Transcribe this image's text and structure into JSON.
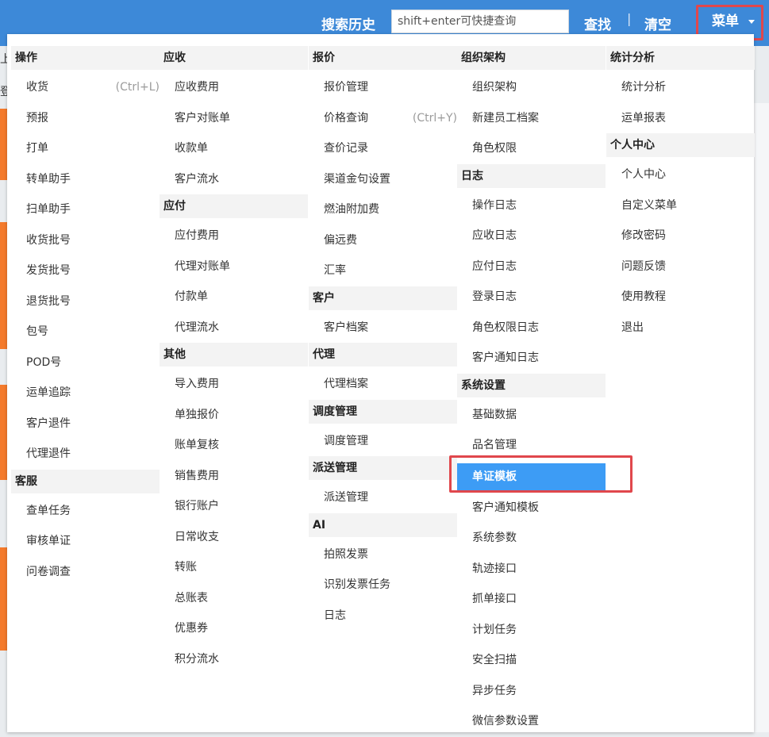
{
  "header": {
    "search_history_label": "搜索历史",
    "search_placeholder": "shift+enter可快捷查询",
    "find_label": "查找",
    "separator": "|",
    "clear_label": "清空",
    "menu_label": "菜单"
  },
  "background": {
    "fragment_char_1": "上",
    "fragment_char_2": "登"
  },
  "menu": {
    "col0": {
      "g0": {
        "title": "操作",
        "items": [
          {
            "label": "收货",
            "shortcut": "(Ctrl+L)"
          },
          {
            "label": "预报"
          },
          {
            "label": "打单"
          },
          {
            "label": "转单助手"
          },
          {
            "label": "扫单助手"
          },
          {
            "label": "收货批号"
          },
          {
            "label": "发货批号"
          },
          {
            "label": "退货批号"
          },
          {
            "label": "包号"
          },
          {
            "label": "POD号"
          },
          {
            "label": "运单追踪"
          },
          {
            "label": "客户退件"
          },
          {
            "label": "代理退件"
          }
        ]
      },
      "g1": {
        "title": "客服",
        "items": [
          {
            "label": "查单任务"
          },
          {
            "label": "审核单证"
          },
          {
            "label": "问卷调查"
          }
        ]
      }
    },
    "col1": {
      "g0": {
        "title": "应收",
        "items": [
          {
            "label": "应收费用"
          },
          {
            "label": "客户对账单"
          },
          {
            "label": "收款单"
          },
          {
            "label": "客户流水"
          }
        ]
      },
      "g1": {
        "title": "应付",
        "items": [
          {
            "label": "应付费用"
          },
          {
            "label": "代理对账单"
          },
          {
            "label": "付款单"
          },
          {
            "label": "代理流水"
          }
        ]
      },
      "g2": {
        "title": "其他",
        "items": [
          {
            "label": "导入费用"
          },
          {
            "label": "单独报价"
          },
          {
            "label": "账单复核"
          },
          {
            "label": "销售费用"
          },
          {
            "label": "银行账户"
          },
          {
            "label": "日常收支"
          },
          {
            "label": "转账"
          },
          {
            "label": "总账表"
          },
          {
            "label": "优惠券"
          },
          {
            "label": "积分流水"
          }
        ]
      }
    },
    "col2": {
      "g0": {
        "title": "报价",
        "items": [
          {
            "label": "报价管理"
          },
          {
            "label": "价格查询",
            "shortcut": "(Ctrl+Y)"
          },
          {
            "label": "查价记录"
          },
          {
            "label": "渠道金句设置"
          },
          {
            "label": "燃油附加费"
          },
          {
            "label": "偏远费"
          },
          {
            "label": "汇率"
          }
        ]
      },
      "g1": {
        "title": "客户",
        "items": [
          {
            "label": "客户档案"
          }
        ]
      },
      "g2": {
        "title": "代理",
        "items": [
          {
            "label": "代理档案"
          }
        ]
      },
      "g3": {
        "title": "调度管理",
        "items": [
          {
            "label": "调度管理"
          }
        ]
      },
      "g4": {
        "title": "派送管理",
        "items": [
          {
            "label": "派送管理"
          }
        ]
      },
      "g5": {
        "title": "AI",
        "items": [
          {
            "label": "拍照发票"
          },
          {
            "label": "识别发票任务"
          },
          {
            "label": "日志"
          }
        ]
      }
    },
    "col3": {
      "g0": {
        "title": "组织架构",
        "items": [
          {
            "label": "组织架构"
          },
          {
            "label": "新建员工档案"
          },
          {
            "label": "角色权限"
          }
        ]
      },
      "g1": {
        "title": "日志",
        "items": [
          {
            "label": "操作日志"
          },
          {
            "label": "应收日志"
          },
          {
            "label": "应付日志"
          },
          {
            "label": "登录日志"
          },
          {
            "label": "角色权限日志"
          },
          {
            "label": "客户通知日志"
          }
        ]
      },
      "g2": {
        "title": "系统设置",
        "items": [
          {
            "label": "基础数据"
          },
          {
            "label": "品名管理"
          },
          {
            "label": "单证模板"
          },
          {
            "label": "客户通知模板"
          },
          {
            "label": "系统参数"
          },
          {
            "label": "轨迹接口"
          },
          {
            "label": "抓单接口"
          },
          {
            "label": "计划任务"
          },
          {
            "label": "安全扫描"
          },
          {
            "label": "异步任务"
          },
          {
            "label": "微信参数设置"
          }
        ]
      }
    },
    "col4": {
      "g0": {
        "title": "统计分析",
        "items": [
          {
            "label": "统计分析"
          },
          {
            "label": "运单报表"
          }
        ]
      },
      "g1": {
        "title": "个人中心",
        "items": [
          {
            "label": "个人中心"
          },
          {
            "label": "自定义菜单"
          },
          {
            "label": "修改密码"
          },
          {
            "label": "问题反馈"
          },
          {
            "label": "使用教程"
          },
          {
            "label": "退出"
          }
        ]
      }
    }
  },
  "colors": {
    "header_bg": "#3d89d8",
    "active_item_bg": "#3d9cf5",
    "highlight_outline": "#e0474c",
    "group_header_bg": "#f3f3f3",
    "background_accent": "#f47a2b"
  }
}
